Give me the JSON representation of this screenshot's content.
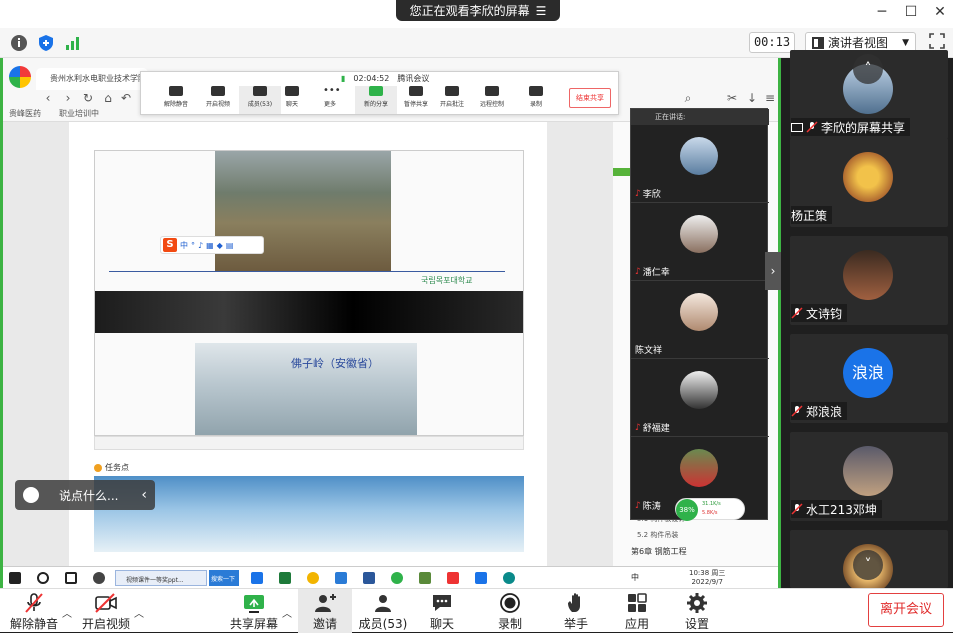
{
  "banner": {
    "text": "您正在观看李欣的屏幕"
  },
  "infobar": {
    "timer": "00:13",
    "view_label": "演讲者视图"
  },
  "shared_screen": {
    "browser_tab": "贵州水利水电职业技术学院",
    "bookmarks": [
      "贵峰医药",
      "职业培训中"
    ],
    "meeting_bar": {
      "duration": "02:04:52",
      "app_name": "腾讯会议",
      "items": [
        "解除静音",
        "开启视频",
        "成员(53)",
        "聊天",
        "更多",
        "新的分享",
        "暂停共享",
        "开启批注",
        "远程控制",
        "录制"
      ],
      "end_share": "结束共享"
    },
    "ime_label": "中",
    "slide_caption": "佛子岭（安徽省）",
    "slide_logo": "국립목포대학교",
    "task_point": "任务点",
    "comment_placeholder": "说点什么...",
    "strip_header": "正在讲话:",
    "strip_names": [
      "李欣",
      "潘仁幸",
      "陈文祥",
      "舒福建",
      "陈涛"
    ],
    "lesson_items": [
      "5.1 构件板设计",
      "5.2 构件吊装",
      "第6章 钢筋工程"
    ],
    "cpu": {
      "percent": "38%",
      "up": "31.1K/s",
      "down": "5.8K/s"
    },
    "taskbar": {
      "task1": "视频课件一等奖ppt...",
      "task2": "搜索一下",
      "ime": "中",
      "time": "10:38 周三",
      "date": "2022/9/7"
    }
  },
  "panel": {
    "tiles": [
      {
        "name": "李欣的屏幕共享",
        "avatar_color": "#6f8fb0"
      },
      {
        "name": "杨正策",
        "avatar_color": "#d9a54a"
      },
      {
        "name": "文诗钧",
        "avatar_color": "#8a4a30"
      },
      {
        "name": "郑浪浪",
        "avatar_text": "浪浪",
        "avatar_color": "#1a73e8"
      },
      {
        "name": "水工213邓坤",
        "avatar_color": "#7a6a8a"
      },
      {
        "name": "",
        "avatar_color": "#d8a35a"
      }
    ]
  },
  "bottombar": {
    "unmute": "解除静音",
    "video": "开启视频",
    "share": "共享屏幕",
    "invite": "邀请",
    "members": "成员(53)",
    "chat": "聊天",
    "record": "录制",
    "raise_hand": "举手",
    "apps": "应用",
    "settings": "设置",
    "leave": "离开会议"
  },
  "colors": {
    "accent_green": "#3db343",
    "leave_red": "#e02b2b",
    "panel_bg": "#1f1f1f"
  }
}
